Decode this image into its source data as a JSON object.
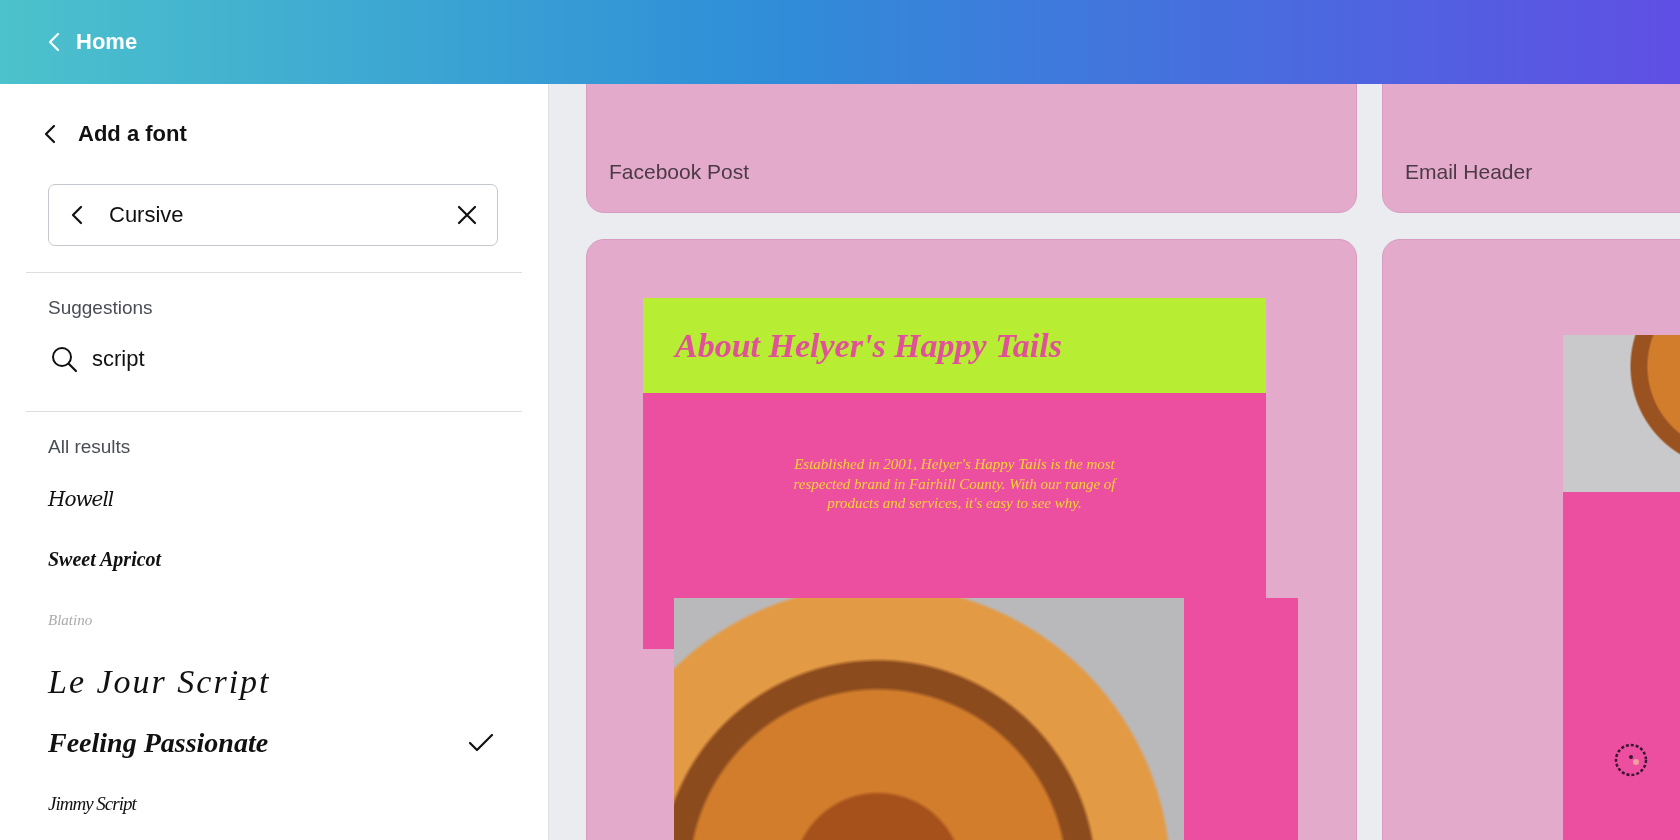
{
  "top_bar": {
    "back_label": "Home"
  },
  "panel": {
    "title": "Add a font",
    "search": {
      "value": "Cursive"
    },
    "suggestions_heading": "Suggestions",
    "suggestions": [
      {
        "label": "script"
      }
    ],
    "results_heading": "All results",
    "results": [
      {
        "label": "Howell",
        "selected": false
      },
      {
        "label": "Sweet Apricot",
        "selected": false
      },
      {
        "label": "Blatino",
        "selected": false
      },
      {
        "label": "Le Jour Script",
        "selected": false
      },
      {
        "label": "Feeling Passionate",
        "selected": true
      },
      {
        "label": "Jimmy Script",
        "selected": false
      }
    ]
  },
  "canvas": {
    "cards": [
      {
        "label": "Facebook Post"
      },
      {
        "label": "Email Header"
      }
    ],
    "design": {
      "heading": "About Helyer's Happy Tails",
      "body": "Established in 2001, Helyer's Happy Tails is the most respected brand in Fairhill County. With our range of products and services, it's easy to see why."
    }
  }
}
